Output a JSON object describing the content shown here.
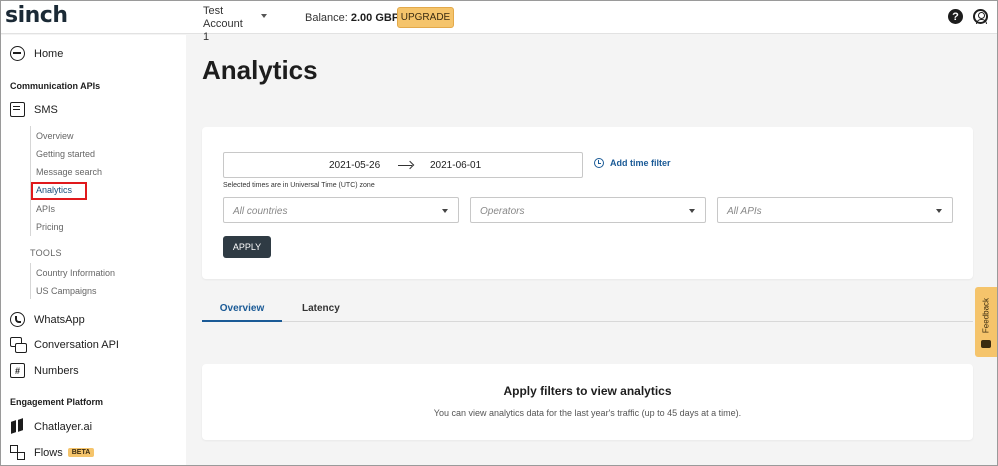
{
  "header": {
    "logo": "sinch",
    "account": "Test Account 1",
    "balance_label": "Balance:",
    "balance_value": "2.00 GBP",
    "upgrade_label": "UPGRADE",
    "help_icon": "help-icon",
    "profile_icon": "user-circle-icon"
  },
  "sidebar": {
    "home": "Home",
    "section_comm": "Communication APIs",
    "sms": "SMS",
    "sms_items": [
      "Overview",
      "Getting started",
      "Message search",
      "Analytics",
      "APIs",
      "Pricing"
    ],
    "tools_heading": "TOOLS",
    "tools_items": [
      "Country Information",
      "US Campaigns"
    ],
    "whatsapp": "WhatsApp",
    "conversation": "Conversation API",
    "numbers": "Numbers",
    "section_engage": "Engagement Platform",
    "chatlayer": "Chatlayer.ai",
    "flows": "Flows",
    "flows_badge": "BETA"
  },
  "page": {
    "title": "Analytics"
  },
  "filters": {
    "date_start": "2021-05-26",
    "date_end": "2021-06-01",
    "add_time_filter": "Add time filter",
    "utc_note": "Selected times are in Universal Time (UTC) zone",
    "countries_placeholder": "All countries",
    "operators_placeholder": "Operators",
    "apis_placeholder": "All APIs",
    "apply_label": "APPLY"
  },
  "tabs": [
    "Overview",
    "Latency"
  ],
  "empty_state": {
    "title": "Apply filters to view analytics",
    "text": "You can view analytics data for the last year's traffic (up to 45 days at a time)."
  },
  "feedback": {
    "label": "Feedback"
  },
  "colors": {
    "accent": "#1a5a96",
    "upgrade": "#f5c46b",
    "apply_button": "#2f3b44",
    "highlight_box": "#e0191c"
  }
}
